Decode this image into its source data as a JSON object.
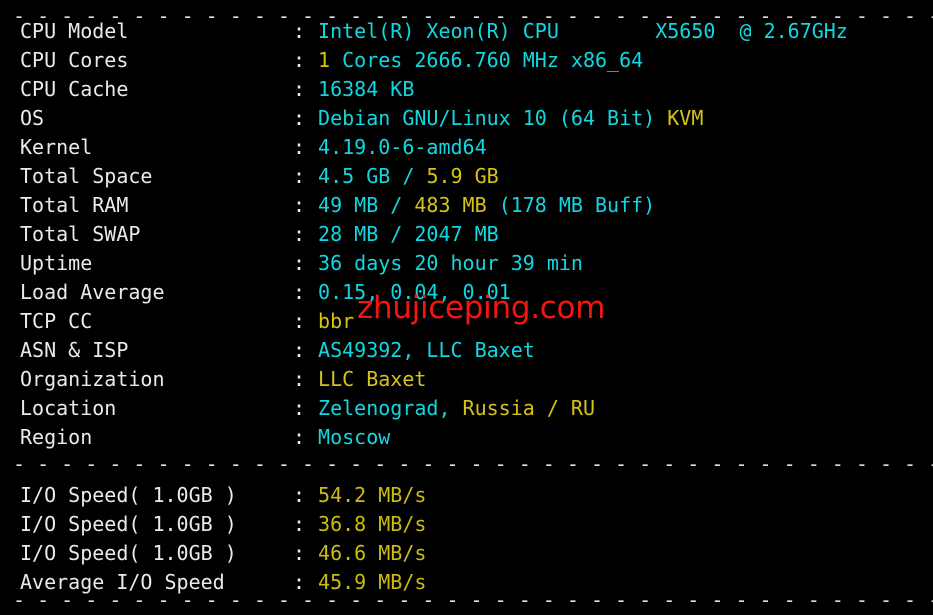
{
  "terminal": {
    "background": "#000000",
    "label_color": "#e8eaed",
    "cyan": "#12d7e0",
    "yellow": "#d6c318",
    "rule_color": "#d8dee9",
    "watermark_color": "#f41410"
  },
  "separators": {
    "dashes": "- - - - - - - - - - - - - - - - - - - - - - - - - - - - - - - - - - - - - - - - - - - - - - - - - - - - - - - -"
  },
  "colon": ":",
  "watermark": {
    "text": "zhujiceping.com"
  },
  "system_info": [
    {
      "label": "CPU Model",
      "segments": [
        {
          "text": "Intel(R) Xeon(R) CPU        X5650  @ 2.67GHz",
          "color": "cyan"
        }
      ]
    },
    {
      "label": "CPU Cores",
      "segments": [
        {
          "text": "1",
          "color": "yellow"
        },
        {
          "text": " Cores ",
          "color": "cyan"
        },
        {
          "text": "2666.760",
          "color": "cyan"
        },
        {
          "text": " MHz ",
          "color": "cyan"
        },
        {
          "text": "x86_64",
          "color": "cyan"
        }
      ]
    },
    {
      "label": "CPU Cache",
      "segments": [
        {
          "text": "16384 KB",
          "color": "cyan"
        }
      ]
    },
    {
      "label": "OS",
      "segments": [
        {
          "text": "Debian GNU/Linux 10 (64 Bit) ",
          "color": "cyan"
        },
        {
          "text": "KVM",
          "color": "yellow"
        }
      ]
    },
    {
      "label": "Kernel",
      "segments": [
        {
          "text": "4.19.0-6-amd64",
          "color": "cyan"
        }
      ]
    },
    {
      "label": "Total Space",
      "segments": [
        {
          "text": "4.5 GB ",
          "color": "cyan"
        },
        {
          "text": "/ ",
          "color": "cyan"
        },
        {
          "text": "5.9 GB",
          "color": "yellow"
        }
      ]
    },
    {
      "label": "Total RAM",
      "segments": [
        {
          "text": "49 MB ",
          "color": "cyan"
        },
        {
          "text": "/ ",
          "color": "cyan"
        },
        {
          "text": "483 MB ",
          "color": "yellow"
        },
        {
          "text": "(178 MB Buff)",
          "color": "cyan"
        }
      ]
    },
    {
      "label": "Total SWAP",
      "segments": [
        {
          "text": "28 MB / 2047 MB",
          "color": "cyan"
        }
      ]
    },
    {
      "label": "Uptime",
      "segments": [
        {
          "text": "36 days 20 hour 39 min",
          "color": "cyan"
        }
      ]
    },
    {
      "label": "Load Average",
      "segments": [
        {
          "text": "0.15, 0.04, 0.01",
          "color": "cyan"
        }
      ]
    },
    {
      "label": "TCP CC",
      "segments": [
        {
          "text": "bbr",
          "color": "yellow"
        }
      ]
    },
    {
      "label": "ASN & ISP",
      "segments": [
        {
          "text": "AS49392, LLC Baxet",
          "color": "cyan"
        }
      ]
    },
    {
      "label": "Organization",
      "segments": [
        {
          "text": "LLC Baxet",
          "color": "yellow"
        }
      ]
    },
    {
      "label": "Location",
      "segments": [
        {
          "text": "Zelenograd, ",
          "color": "cyan"
        },
        {
          "text": "Russia / RU",
          "color": "yellow"
        }
      ]
    },
    {
      "label": "Region",
      "segments": [
        {
          "text": "Moscow",
          "color": "cyan"
        }
      ]
    }
  ],
  "io_results": [
    {
      "label": "I/O Speed( 1.0GB )",
      "segments": [
        {
          "text": "54.2 MB/s",
          "color": "ioyellow"
        }
      ]
    },
    {
      "label": "I/O Speed( 1.0GB )",
      "segments": [
        {
          "text": "36.8 MB/s",
          "color": "ioyellow"
        }
      ]
    },
    {
      "label": "I/O Speed( 1.0GB )",
      "segments": [
        {
          "text": "46.6 MB/s",
          "color": "ioyellow"
        }
      ]
    },
    {
      "label": "Average I/O Speed",
      "segments": [
        {
          "text": "45.9 MB/s",
          "color": "ioyellow"
        }
      ]
    }
  ]
}
